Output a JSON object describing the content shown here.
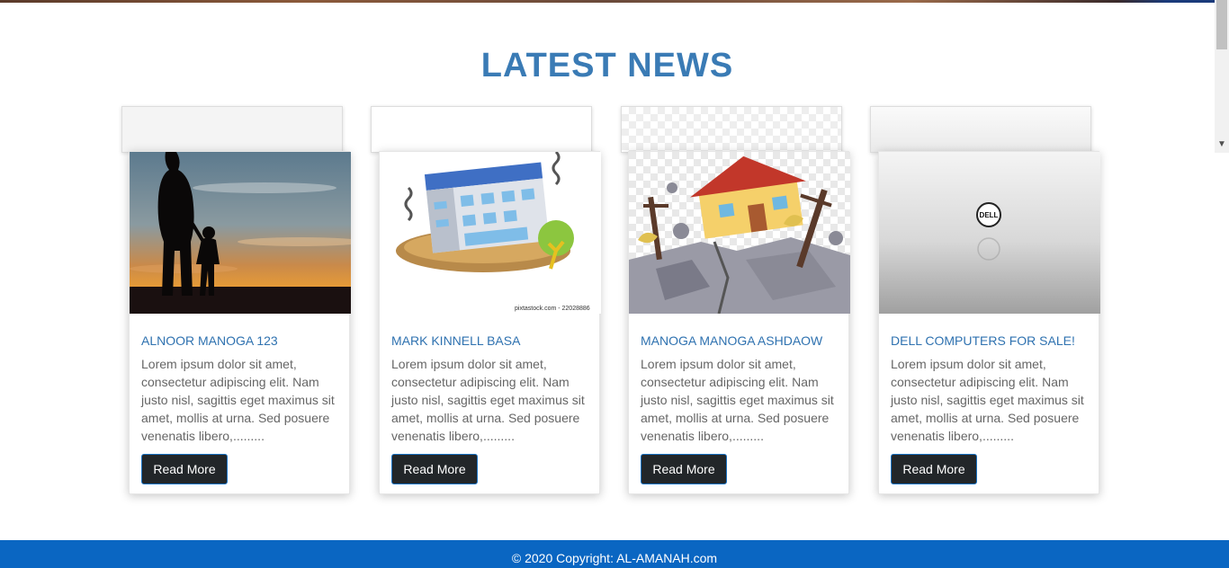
{
  "section": {
    "title": "LATEST NEWS"
  },
  "cards": [
    {
      "title": "ALNOOR MANOGA 123",
      "body": "Lorem ipsum dolor sit amet, consectetur adipiscing elit. Nam justo nisl, sagittis eget maximus sit amet, mollis at urna. Sed posuere venenatis libero,.........",
      "button": "Read More",
      "image": "silhouette-sunset-image"
    },
    {
      "title": "MARK KINNELL BASA",
      "body": "Lorem ipsum dolor sit amet, consectetur adipiscing elit. Nam justo nisl, sagittis eget maximus sit amet, mollis at urna. Sed posuere venenatis libero,.........",
      "button": "Read More",
      "image": "tilted-building-image",
      "watermark": "pixtastock.com - 22028886"
    },
    {
      "title": "MANOGA MANOGA ASHDAOW",
      "body": "Lorem ipsum dolor sit amet, consectetur adipiscing elit. Nam justo nisl, sagittis eget maximus sit amet, mollis at urna. Sed posuere venenatis libero,.........",
      "button": "Read More",
      "image": "earthquake-house-image"
    },
    {
      "title": "DELL COMPUTERS FOR SALE!",
      "body": "Lorem ipsum dolor sit amet, consectetur adipiscing elit. Nam justo nisl, sagittis eget maximus sit amet, mollis at urna. Sed posuere venenatis libero,.........",
      "button": "Read More",
      "image": "dell-logo-image",
      "logo_text": "DELL"
    }
  ],
  "footer": {
    "copyright": "© 2020 Copyright: AL-AMANAH.com"
  },
  "colors": {
    "title": "#3a7bb5",
    "card_title": "#2f72b0",
    "footer": "#0a66c2",
    "button": "#222629"
  }
}
